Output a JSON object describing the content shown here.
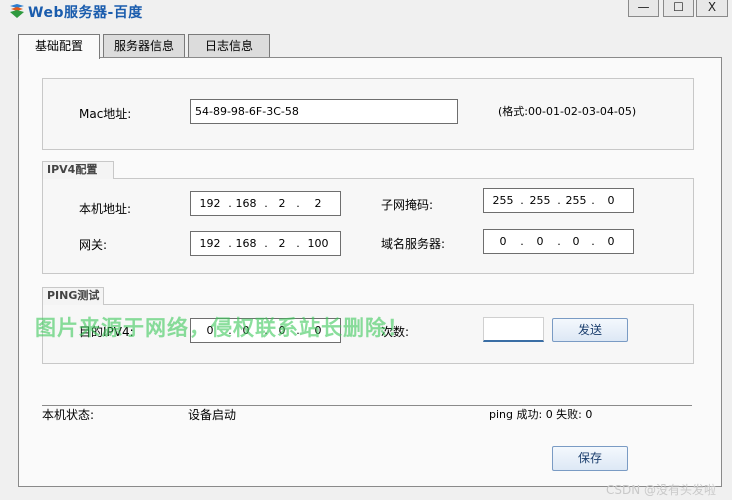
{
  "window": {
    "title": "Web服务器-百度",
    "app_icon": "app-logo-icon",
    "buttons": {
      "minimize": "—",
      "maximize": "☐",
      "close": "X"
    }
  },
  "tabs": [
    {
      "label": "基础配置",
      "active": true
    },
    {
      "label": "服务器信息",
      "active": false
    },
    {
      "label": "日志信息",
      "active": false
    }
  ],
  "mac_section": {
    "label": "Mac地址:",
    "value": "54-89-98-6F-3C-58",
    "format_hint": "(格式:00-01-02-03-04-05)"
  },
  "ipv4_section": {
    "title": "IPV4配置",
    "local_ip": {
      "label": "本机地址:",
      "octets": [
        "192",
        "168",
        "2",
        "2"
      ]
    },
    "subnet_mask": {
      "label": "子网掩码:",
      "octets": [
        "255",
        "255",
        "255",
        "0"
      ]
    },
    "gateway": {
      "label": "网关:",
      "octets": [
        "192",
        "168",
        "2",
        "100"
      ]
    },
    "dns": {
      "label": "域名服务器:",
      "octets": [
        "0",
        "0",
        "0",
        "0"
      ]
    }
  },
  "ping_section": {
    "title": "PING测试",
    "target": {
      "label": "目的IPV4:",
      "octets": [
        "0",
        "0",
        "0",
        "0"
      ]
    },
    "count": {
      "label": "次数:",
      "value": ""
    },
    "send_button": "发送"
  },
  "status": {
    "label": "本机状态:",
    "value": "设备启动",
    "ping_result": "ping 成功: 0 失败: 0"
  },
  "save_button": "保存",
  "overlay_watermark": "图片来源于网络，侵权联系站长删除！",
  "credit": "CSDN @没有头发啦",
  "colors": {
    "title": "#1a5cad",
    "button_text": "#1c3f6e",
    "watermark": "#3cc85a"
  }
}
